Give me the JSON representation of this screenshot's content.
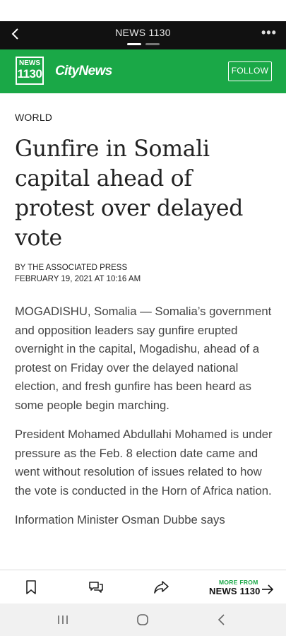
{
  "topbar": {
    "title": "NEWS 1130",
    "back_icon": "chevron-left-icon",
    "more_label": "•••"
  },
  "brand": {
    "logo_line1": "NEWS",
    "logo_line2": "1130",
    "wordmark": "CityNews",
    "follow_label": "FOLLOW",
    "accent": "#1aa847"
  },
  "article": {
    "section": "WORLD",
    "headline": "Gunfire in Somali capital ahead of protest over delayed vote",
    "byline": "BY THE ASSOCIATED PRESS",
    "dateline": "FEBRUARY 19, 2021 AT 10:16 AM",
    "paragraphs": [
      "MOGADISHU, Somalia — Somalia’s government and opposition leaders say gunfire erupted overnight in the capital, Mogadishu, ahead of a protest on Friday over the delayed national election, and fresh gunfire has been heard as some people begin marching.",
      "President Mohamed Abdullahi Mohamed is under pressure as the Feb. 8 election date came and went without resolution of issues related to how the vote is conducted in the Horn of Africa nation.",
      "Information Minister Osman Dubbe says"
    ]
  },
  "footer": {
    "bookmark_icon": "bookmark-icon",
    "comment_icon": "comment-icon",
    "share_icon": "share-icon",
    "more_from_small": "MORE FROM",
    "more_from_big": "NEWS 1130"
  },
  "system_nav": {
    "recents": "recents-icon",
    "home": "home-icon",
    "back": "back-icon"
  }
}
